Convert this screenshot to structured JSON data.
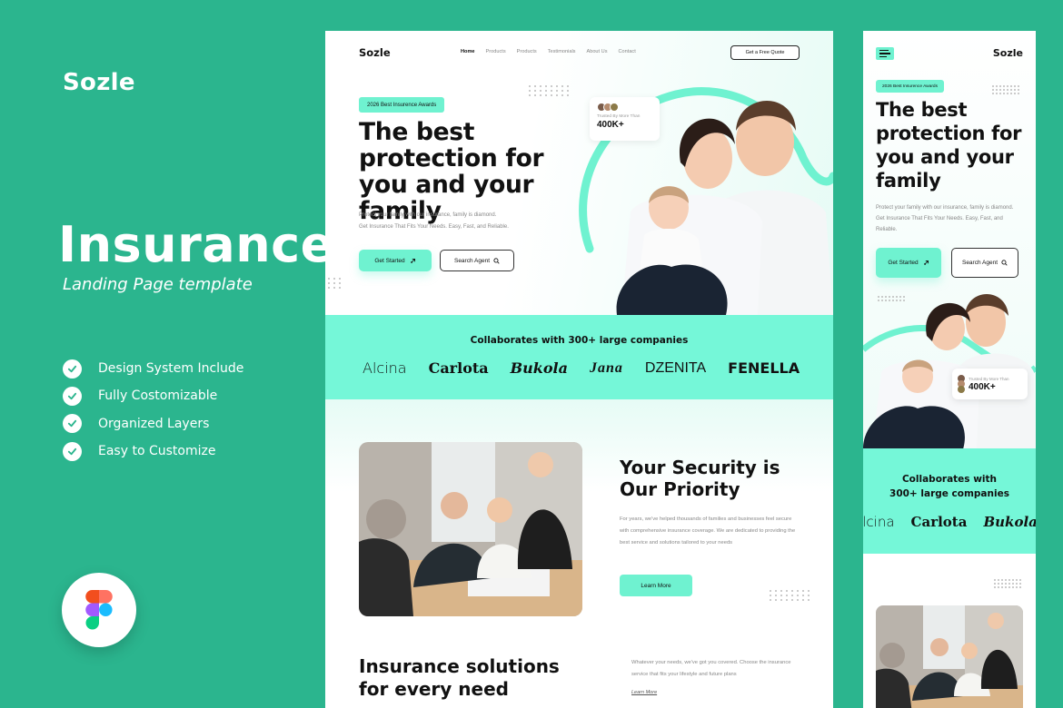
{
  "colors": {
    "background": "#2bb58e",
    "accent": "#6ff2d0",
    "accent_band": "#75f7d8",
    "text_dark": "#111111",
    "text_muted": "#888888"
  },
  "promo": {
    "brand": "Sozle",
    "title": "Insurance",
    "subtitle": "Landing Page template",
    "features": [
      {
        "label": "Design System Include",
        "icon": "check-circle-icon"
      },
      {
        "label": "Fully Costomizable",
        "icon": "check-circle-icon"
      },
      {
        "label": "Organized Layers",
        "icon": "check-circle-icon"
      },
      {
        "label": "Easy to Customize",
        "icon": "check-circle-icon"
      }
    ],
    "badge_icon": "figma-logo-icon"
  },
  "desktop": {
    "nav": {
      "logo": "Sozle",
      "links": [
        "Home",
        "Products",
        "Products",
        "Testimonials",
        "About Us",
        "Contact"
      ],
      "active_index": 0,
      "cta": "Get a Free Quote"
    },
    "hero": {
      "badge": "2026 Best Insurence Awards",
      "title": "The best protection for you and your family",
      "description_line1": "Protect your family with our insurance, family is diamond.",
      "description_line2": "Get Insurance That Fits Your Needs. Easy, Fast, and Reliable.",
      "primary_button": "Get Started",
      "primary_icon": "rocket-icon",
      "secondary_button": "Search Agent",
      "secondary_icon": "search-icon",
      "trust_label": "Trusted By More Than",
      "trust_value": "400K+",
      "image": "family-photo"
    },
    "collab": {
      "title": "Collaborates with 300+ large companies",
      "logos": [
        "Alcina",
        "Carlota",
        "Bukola",
        "Jana",
        "DZENITA",
        "FENELLA"
      ]
    },
    "security": {
      "title": "Your Security is Our Priority",
      "description": "For years, we've helped thousands of families and businesses feel secure with comprehensive insurance coverage. We are dedicated to providing the best service and solutions tailored to your needs",
      "button": "Learn More",
      "image": "meeting-photo"
    },
    "solutions": {
      "title": "Insurance solutions for every need",
      "description": "Whatever your needs, we've got you covered. Choose the insurance service that fits your lifestyle and future plans",
      "link": "Learn More"
    }
  },
  "mobile": {
    "logo": "Sozle",
    "menu_icon": "hamburger-menu-icon",
    "badge": "2026 Best Insurence Awards",
    "title": "The best protection for you and your family",
    "description": "Protect your family with our insurance, family is diamond. Get Insurance That Fits Your Needs. Easy, Fast, and Reliable.",
    "primary_button": "Get Started",
    "secondary_button": "Search Agent",
    "trust_label": "Trusted By More Than",
    "trust_value": "400K+",
    "collab_title_line1": "Collaborates with",
    "collab_title_line2": "300+ large companies",
    "logos": [
      "Alcina",
      "Carlota",
      "Bukola"
    ]
  }
}
